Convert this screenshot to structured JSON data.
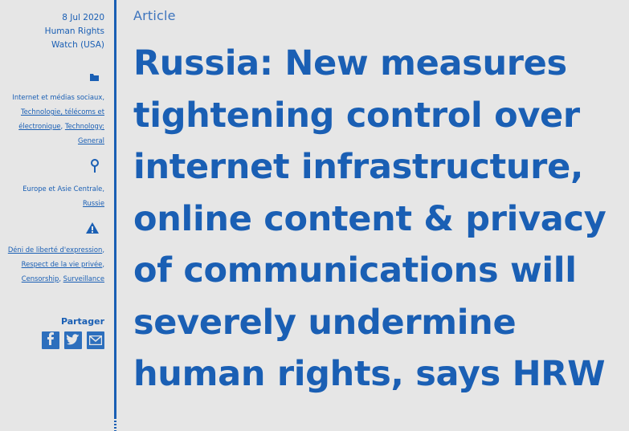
{
  "sidebar": {
    "date": "8 Jul 2020",
    "source": "Human Rights Watch (USA)",
    "topics_icon": "folder-icon",
    "topics": [
      {
        "label": "Internet et médias sociaux",
        "link": false
      },
      {
        "label": "Technologie, télécoms et électronique",
        "link": true
      },
      {
        "label": "Technology: General",
        "link": true
      }
    ],
    "region_icon": "location-pin-icon",
    "regions": [
      {
        "label": "Europe et Asie Centrale",
        "link": false
      },
      {
        "label": "Russie",
        "link": true
      }
    ],
    "issues_icon": "warning-icon",
    "issues": [
      {
        "label": "Déni de liberté d'expression",
        "link": true
      },
      {
        "label": "Respect de la vie privée",
        "link": true
      },
      {
        "label": "Censorship",
        "link": true
      },
      {
        "label": "Surveillance",
        "link": true
      }
    ],
    "share_label": "Partager",
    "share_icons": [
      "facebook-icon",
      "twitter-icon",
      "email-icon"
    ]
  },
  "main": {
    "article_type": "Article",
    "headline": "Russia: New measures tightening control over internet infrastructure, online content & privacy of communications will severely undermine human rights, says HRW"
  },
  "colors": {
    "accent": "#1a5fb4",
    "background": "#e6e6e6"
  }
}
